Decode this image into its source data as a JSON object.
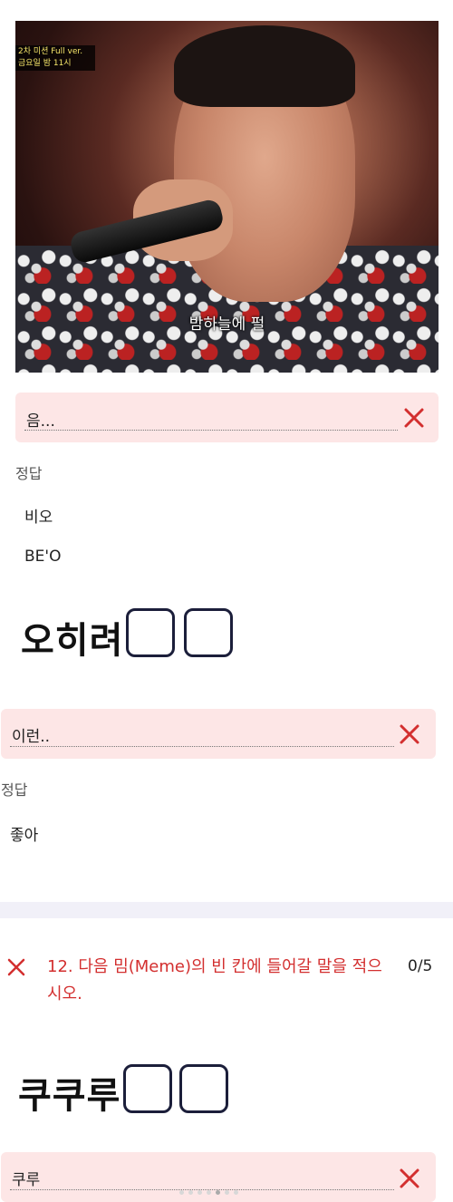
{
  "photo": {
    "badge_line1": "2차 미션 Full ver.",
    "badge_line2": "금요일 밤 11시",
    "caption": "밤하늘에 펄"
  },
  "q11": {
    "answer": "음...",
    "answer_label": "정답",
    "options": [
      "비오",
      "BE'O"
    ]
  },
  "meme1": {
    "text": "오히려"
  },
  "q11b": {
    "answer": "이런..",
    "answer_label": "정답",
    "options": [
      "좋아"
    ]
  },
  "q12": {
    "title": "12. 다음 밈(Meme)의 빈 칸에 들어갈 말을 적으시오.",
    "score": "0/5"
  },
  "meme2": {
    "text": "쿠쿠루"
  },
  "q12_answer": {
    "answer": "쿠루"
  },
  "colors": {
    "wrong": "#d32f2f",
    "answer_bg": "#fde6e6"
  }
}
